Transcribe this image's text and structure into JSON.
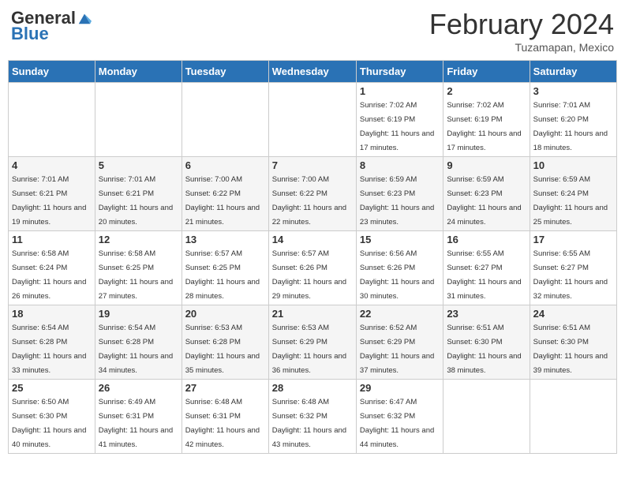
{
  "header": {
    "logo_general": "General",
    "logo_blue": "Blue",
    "month_title": "February 2024",
    "location": "Tuzamapan, Mexico"
  },
  "weekdays": [
    "Sunday",
    "Monday",
    "Tuesday",
    "Wednesday",
    "Thursday",
    "Friday",
    "Saturday"
  ],
  "weeks": [
    [
      {
        "day": "",
        "info": ""
      },
      {
        "day": "",
        "info": ""
      },
      {
        "day": "",
        "info": ""
      },
      {
        "day": "",
        "info": ""
      },
      {
        "day": "1",
        "info": "Sunrise: 7:02 AM\nSunset: 6:19 PM\nDaylight: 11 hours and 17 minutes."
      },
      {
        "day": "2",
        "info": "Sunrise: 7:02 AM\nSunset: 6:19 PM\nDaylight: 11 hours and 17 minutes."
      },
      {
        "day": "3",
        "info": "Sunrise: 7:01 AM\nSunset: 6:20 PM\nDaylight: 11 hours and 18 minutes."
      }
    ],
    [
      {
        "day": "4",
        "info": "Sunrise: 7:01 AM\nSunset: 6:21 PM\nDaylight: 11 hours and 19 minutes."
      },
      {
        "day": "5",
        "info": "Sunrise: 7:01 AM\nSunset: 6:21 PM\nDaylight: 11 hours and 20 minutes."
      },
      {
        "day": "6",
        "info": "Sunrise: 7:00 AM\nSunset: 6:22 PM\nDaylight: 11 hours and 21 minutes."
      },
      {
        "day": "7",
        "info": "Sunrise: 7:00 AM\nSunset: 6:22 PM\nDaylight: 11 hours and 22 minutes."
      },
      {
        "day": "8",
        "info": "Sunrise: 6:59 AM\nSunset: 6:23 PM\nDaylight: 11 hours and 23 minutes."
      },
      {
        "day": "9",
        "info": "Sunrise: 6:59 AM\nSunset: 6:23 PM\nDaylight: 11 hours and 24 minutes."
      },
      {
        "day": "10",
        "info": "Sunrise: 6:59 AM\nSunset: 6:24 PM\nDaylight: 11 hours and 25 minutes."
      }
    ],
    [
      {
        "day": "11",
        "info": "Sunrise: 6:58 AM\nSunset: 6:24 PM\nDaylight: 11 hours and 26 minutes."
      },
      {
        "day": "12",
        "info": "Sunrise: 6:58 AM\nSunset: 6:25 PM\nDaylight: 11 hours and 27 minutes."
      },
      {
        "day": "13",
        "info": "Sunrise: 6:57 AM\nSunset: 6:25 PM\nDaylight: 11 hours and 28 minutes."
      },
      {
        "day": "14",
        "info": "Sunrise: 6:57 AM\nSunset: 6:26 PM\nDaylight: 11 hours and 29 minutes."
      },
      {
        "day": "15",
        "info": "Sunrise: 6:56 AM\nSunset: 6:26 PM\nDaylight: 11 hours and 30 minutes."
      },
      {
        "day": "16",
        "info": "Sunrise: 6:55 AM\nSunset: 6:27 PM\nDaylight: 11 hours and 31 minutes."
      },
      {
        "day": "17",
        "info": "Sunrise: 6:55 AM\nSunset: 6:27 PM\nDaylight: 11 hours and 32 minutes."
      }
    ],
    [
      {
        "day": "18",
        "info": "Sunrise: 6:54 AM\nSunset: 6:28 PM\nDaylight: 11 hours and 33 minutes."
      },
      {
        "day": "19",
        "info": "Sunrise: 6:54 AM\nSunset: 6:28 PM\nDaylight: 11 hours and 34 minutes."
      },
      {
        "day": "20",
        "info": "Sunrise: 6:53 AM\nSunset: 6:28 PM\nDaylight: 11 hours and 35 minutes."
      },
      {
        "day": "21",
        "info": "Sunrise: 6:53 AM\nSunset: 6:29 PM\nDaylight: 11 hours and 36 minutes."
      },
      {
        "day": "22",
        "info": "Sunrise: 6:52 AM\nSunset: 6:29 PM\nDaylight: 11 hours and 37 minutes."
      },
      {
        "day": "23",
        "info": "Sunrise: 6:51 AM\nSunset: 6:30 PM\nDaylight: 11 hours and 38 minutes."
      },
      {
        "day": "24",
        "info": "Sunrise: 6:51 AM\nSunset: 6:30 PM\nDaylight: 11 hours and 39 minutes."
      }
    ],
    [
      {
        "day": "25",
        "info": "Sunrise: 6:50 AM\nSunset: 6:30 PM\nDaylight: 11 hours and 40 minutes."
      },
      {
        "day": "26",
        "info": "Sunrise: 6:49 AM\nSunset: 6:31 PM\nDaylight: 11 hours and 41 minutes."
      },
      {
        "day": "27",
        "info": "Sunrise: 6:48 AM\nSunset: 6:31 PM\nDaylight: 11 hours and 42 minutes."
      },
      {
        "day": "28",
        "info": "Sunrise: 6:48 AM\nSunset: 6:32 PM\nDaylight: 11 hours and 43 minutes."
      },
      {
        "day": "29",
        "info": "Sunrise: 6:47 AM\nSunset: 6:32 PM\nDaylight: 11 hours and 44 minutes."
      },
      {
        "day": "",
        "info": ""
      },
      {
        "day": "",
        "info": ""
      }
    ]
  ]
}
